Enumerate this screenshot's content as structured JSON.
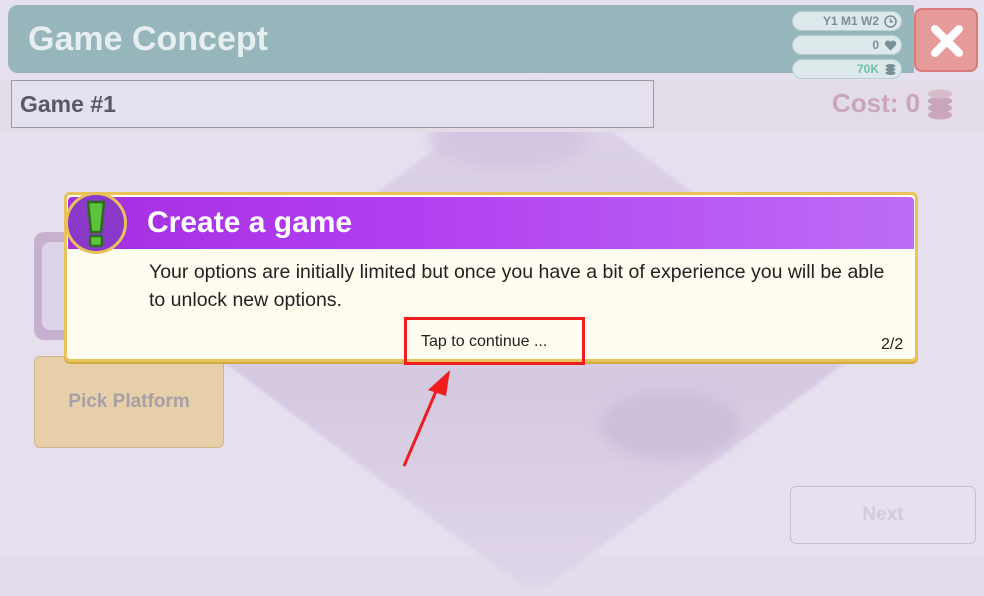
{
  "header": {
    "title": "Game Concept",
    "date": "Y1 M1 W2",
    "fans": "0",
    "money": "70K"
  },
  "concept": {
    "name_value": "Game #1",
    "cost_label": "Cost: 0"
  },
  "buttons": {
    "pick_platform": "Pick Platform",
    "next": "Next"
  },
  "dialog": {
    "title": "Create a game",
    "body": "Your options are initially limited but once you have a bit of experience you will be able to unlock new options.",
    "tap_hint": "Tap to continue ...",
    "page": "2/2"
  },
  "icons": {
    "date": "clock-icon",
    "fans": "heart-icon",
    "money": "coins-icon",
    "close": "close-icon",
    "alert": "exclamation-icon"
  },
  "colors": {
    "accent_purple": "#a52fe0",
    "dialog_border": "#e7c35a",
    "highlight_red": "#ef1d1d",
    "title_bar": "#97b6bb",
    "close_button": "#e79a9a"
  }
}
